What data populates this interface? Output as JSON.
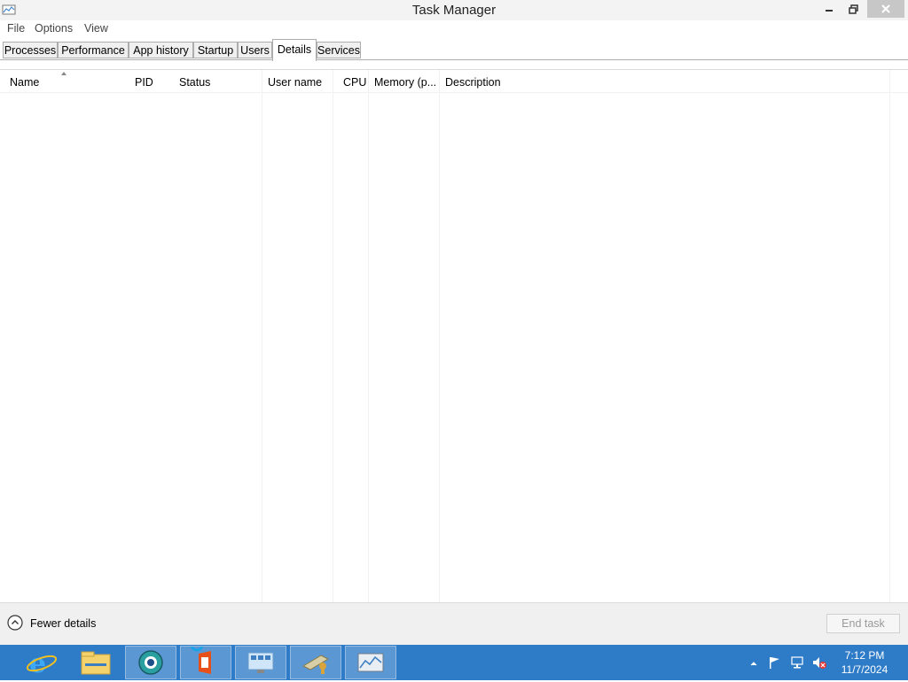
{
  "window": {
    "title": "Task Manager"
  },
  "menu": [
    "File",
    "Options",
    "View"
  ],
  "tabs": [
    {
      "label": "Processes",
      "active": false
    },
    {
      "label": "Performance",
      "active": false
    },
    {
      "label": "App history",
      "active": false
    },
    {
      "label": "Startup",
      "active": false
    },
    {
      "label": "Users",
      "active": false
    },
    {
      "label": "Details",
      "active": true
    },
    {
      "label": "Services",
      "active": false
    }
  ],
  "table": {
    "columns": [
      "Name",
      "PID",
      "Status",
      "User name",
      "CPU",
      "Memory (p...",
      "Description"
    ],
    "sort_column": "Name",
    "rows": []
  },
  "footer": {
    "fewer_details": "Fewer details",
    "end_task": "End task"
  },
  "taskbar": {
    "items": [
      "internet-explorer-icon",
      "file-explorer-icon",
      "browser-icon",
      "office-icon",
      "control-panel-icon",
      "security-icon",
      "task-manager-icon"
    ]
  },
  "clock": {
    "time": "7:12 PM",
    "date": "11/7/2024"
  },
  "colors": {
    "taskbar": "#2e7bc7",
    "title_bg": "#f3f3f3",
    "close_button": "#c7c7c7",
    "footer_bg": "#f0f0f0"
  }
}
